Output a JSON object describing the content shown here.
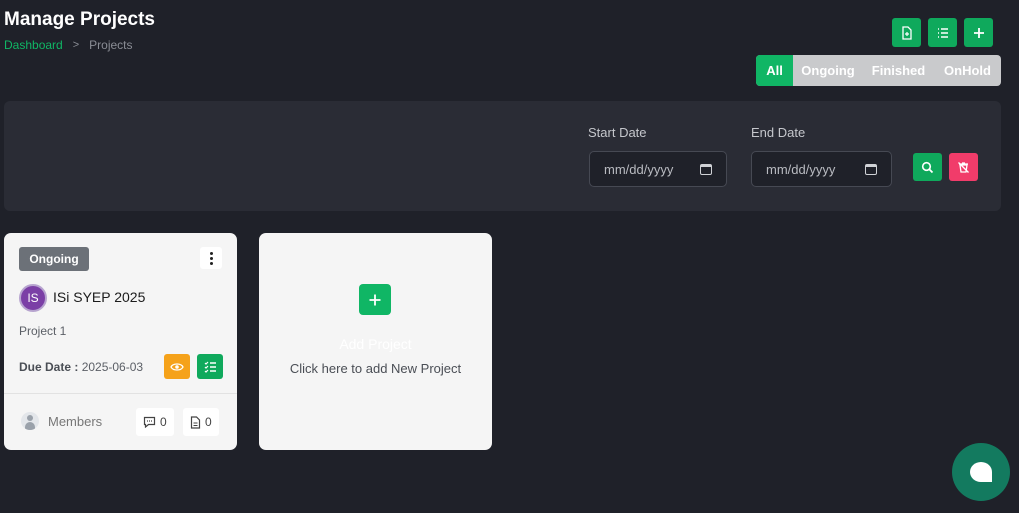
{
  "header": {
    "title": "Manage Projects",
    "breadcrumb": {
      "home": "Dashboard",
      "separator": ">",
      "current": "Projects"
    }
  },
  "toolbar": {
    "icons": [
      "export-file-icon",
      "list-view-icon",
      "plus-icon"
    ]
  },
  "filter_tabs": [
    {
      "label": "All",
      "active": true
    },
    {
      "label": "Ongoing",
      "active": false
    },
    {
      "label": "Finished",
      "active": false
    },
    {
      "label": "OnHold",
      "active": false
    }
  ],
  "filters": {
    "start_date": {
      "label": "Start Date",
      "value": "mm/dd/yyyy"
    },
    "end_date": {
      "label": "End Date",
      "value": "mm/dd/yyyy"
    }
  },
  "project": {
    "status": "Ongoing",
    "avatar_initials": "IS",
    "name": "ISi SYEP 2025",
    "description": "Project 1",
    "due_label": "Due Date :",
    "due_date": "2025-06-03",
    "members_label": "Members",
    "comments_count": "0",
    "files_count": "0"
  },
  "add_project": {
    "title": "Add Project",
    "subtitle": "Click here to add New Project"
  },
  "colors": {
    "accent": "#10b665",
    "danger": "#f13c6a",
    "warning": "#f5a21a",
    "background": "#1f2129",
    "panel": "#2a2c35",
    "chat_fab": "#137a5f"
  }
}
